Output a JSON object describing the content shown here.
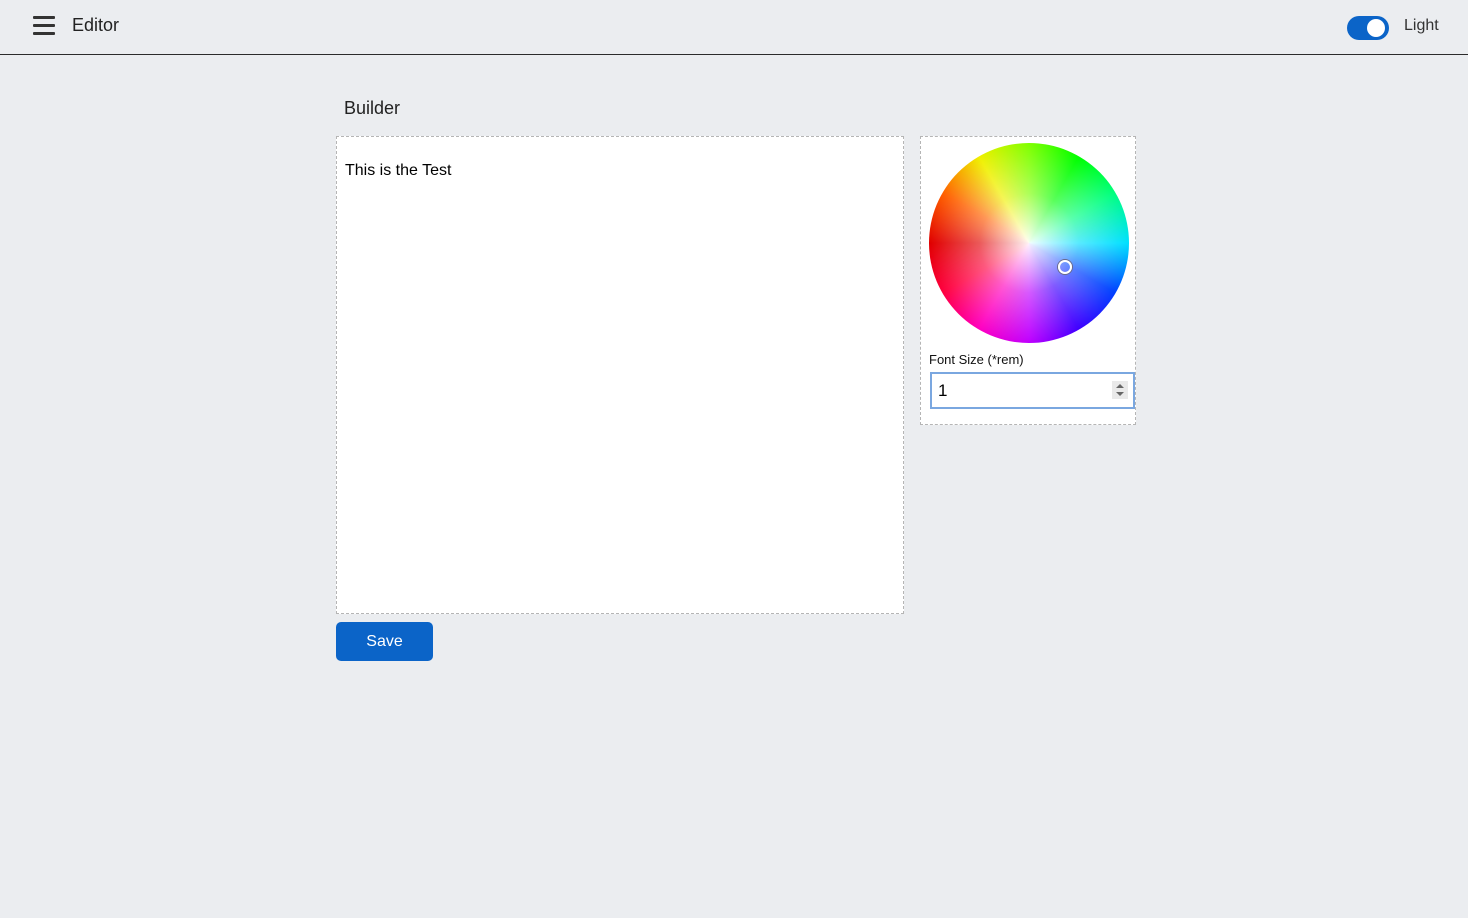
{
  "header": {
    "menu_icon": "hamburger-menu-icon",
    "title": "Editor",
    "theme_toggle": {
      "state": "on",
      "label": "Light",
      "accent": "#0b64c8"
    }
  },
  "builder": {
    "title": "Builder",
    "editor_content": "This is the Test",
    "save_label": "Save"
  },
  "style_panel": {
    "color_picker": "color-wheel",
    "font_size_label": "Font Size (*rem)",
    "font_size_value": "1"
  },
  "colors": {
    "background": "#ebedf0",
    "accent": "#0b64c8",
    "panel": "#ffffff"
  }
}
